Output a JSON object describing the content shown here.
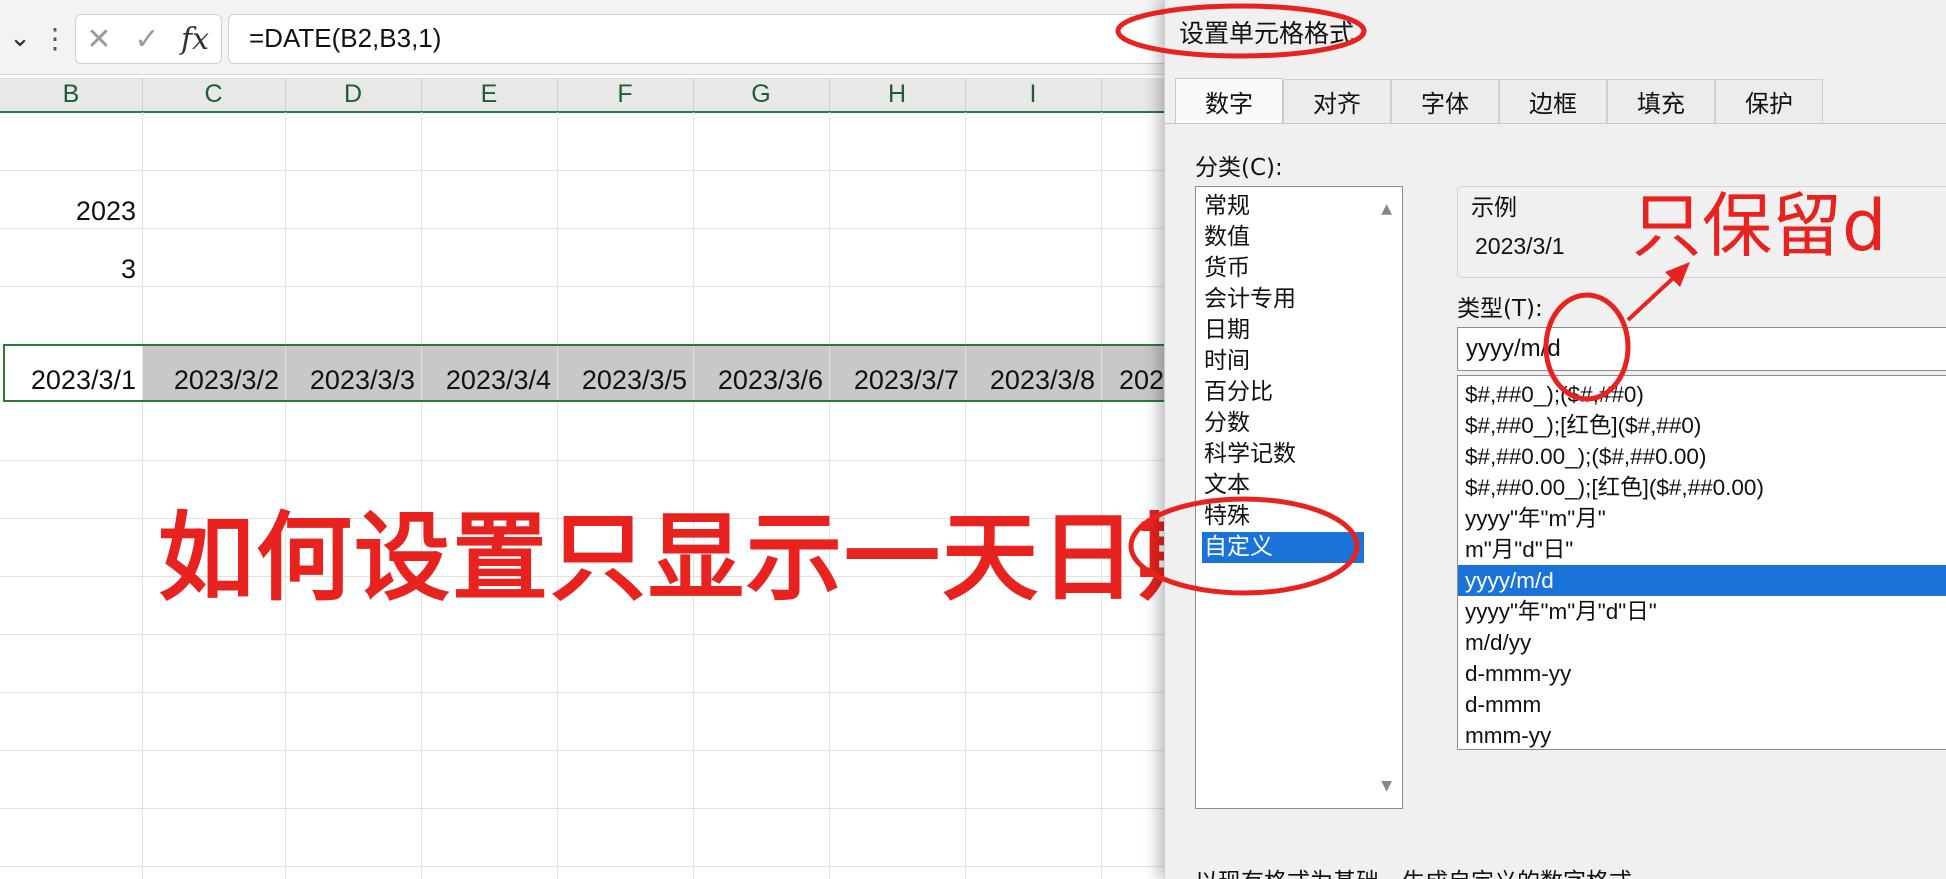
{
  "formula_bar": {
    "name_box_arrow": "⌄",
    "more_icon": "⋮",
    "cancel_glyph": "✕",
    "enter_glyph": "✓",
    "fx_label": "fx",
    "formula": "=DATE(B2,B3,1)"
  },
  "columns": [
    "B",
    "C",
    "D",
    "E",
    "F",
    "G",
    "H",
    "I"
  ],
  "cells": {
    "b2": "2023",
    "b3": "3"
  },
  "dates": [
    "2023/3/1",
    "2023/3/2",
    "2023/3/3",
    "2023/3/4",
    "2023/3/5",
    "2023/3/6",
    "2023/3/7",
    "2023/3/8",
    "202"
  ],
  "annotations": {
    "main": "如何设置只显示一天日期",
    "keep_d": "只保留d",
    "color": "#e8231f"
  },
  "dialog": {
    "title": "设置单元格格式",
    "tabs": [
      "数字",
      "对齐",
      "字体",
      "边框",
      "填充",
      "保护"
    ],
    "active_tab": "数字",
    "category_label": "分类(C):",
    "categories": [
      "常规",
      "数值",
      "货币",
      "会计专用",
      "日期",
      "时间",
      "百分比",
      "分数",
      "科学记数",
      "文本",
      "特殊",
      "自定义"
    ],
    "selected_category": "自定义",
    "sample_label": "示例",
    "sample_value": "2023/3/1",
    "type_label": "类型(T):",
    "type_value": "yyyy/m/d",
    "formats": [
      "$#,##0_);($#,##0)",
      "$#,##0_);[红色]($#,##0)",
      "$#,##0.00_);($#,##0.00)",
      "$#,##0.00_);[红色]($#,##0.00)",
      "yyyy\"年\"m\"月\"",
      "m\"月\"d\"日\"",
      "yyyy/m/d",
      "yyyy\"年\"m\"月\"d\"日\"",
      "m/d/yy",
      "d-mmm-yy",
      "d-mmm",
      "mmm-yy"
    ],
    "selected_format": "yyyy/m/d",
    "description": "以现有格式为基础，生成自定义的数字格式。",
    "accent_color": "#1a73d9"
  }
}
